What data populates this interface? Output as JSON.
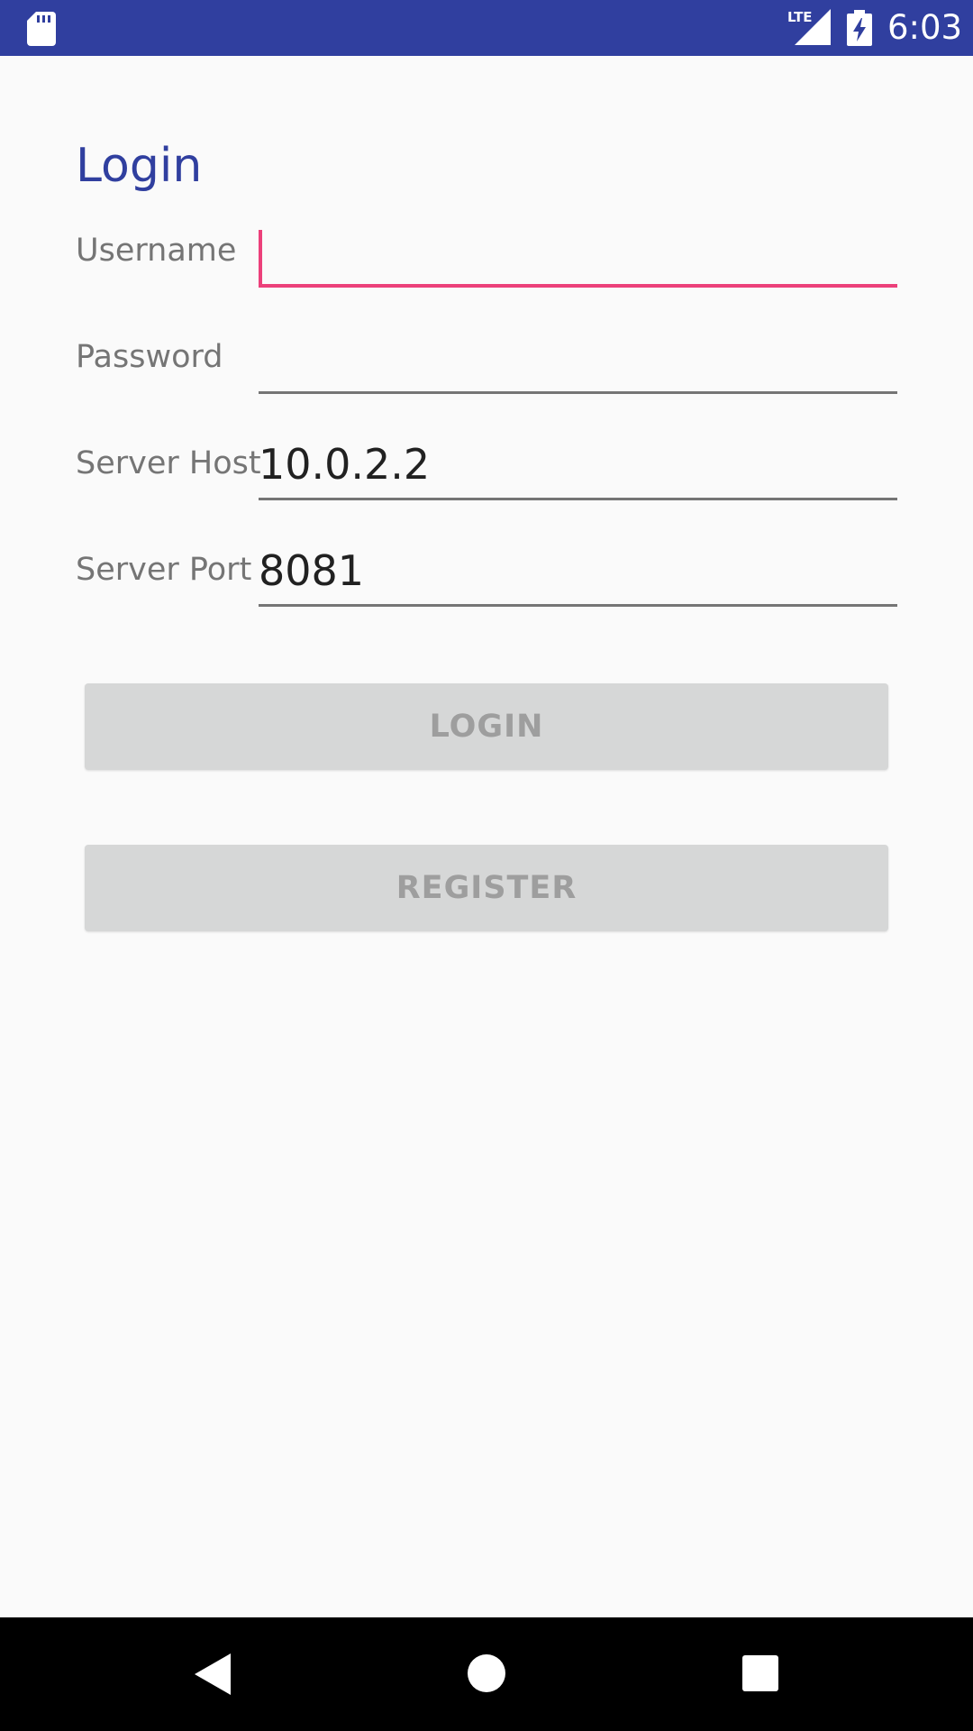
{
  "status_bar": {
    "time": "6:03",
    "network": "LTE",
    "background_color": "#303f9f",
    "icons": [
      "sd-card-icon",
      "lte-signal-icon",
      "battery-charging-icon"
    ]
  },
  "login": {
    "title": "Login",
    "title_color": "#303f9f",
    "fields": [
      {
        "label": "Username",
        "value": "",
        "focused": true
      },
      {
        "label": "Password",
        "value": ""
      },
      {
        "label": "Server Host",
        "value": "10.0.2.2"
      },
      {
        "label": "Server Port",
        "value": "8081"
      }
    ],
    "accent_color": "#ec407a",
    "login_button": "LOGIN",
    "register_button": "REGISTER"
  },
  "navigation_bar": {
    "icons": [
      "back-icon",
      "home-icon",
      "recents-icon"
    ]
  }
}
